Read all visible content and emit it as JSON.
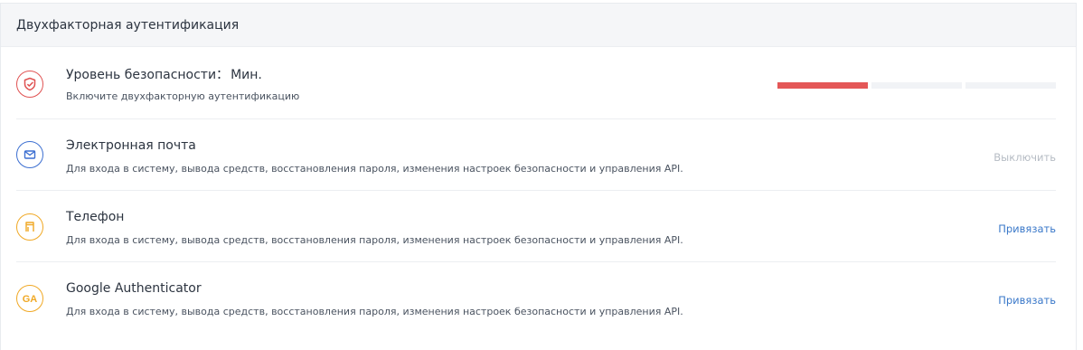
{
  "header": {
    "title": "Двухфакторная аутентификация"
  },
  "security": {
    "label": "Уровень безопасности：",
    "value": "Мин.",
    "description": "Включите двухфакторную аутентификацию",
    "icon": "shield-check-icon",
    "icon_color": "#e05252",
    "level_filled": 1,
    "level_total": 3,
    "filled_color": "#e45757",
    "empty_color": "#f1f3f6"
  },
  "methods": [
    {
      "title": "Электронная почта",
      "description": "Для входа в систему, вывода средств, восстановления пароля, изменения настроек безопасности и управления API.",
      "action": "Выключить",
      "action_color": "#b6bcc4",
      "icon": "envelope-icon",
      "icon_color": "#3c6fd1"
    },
    {
      "title": "Телефон",
      "description": "Для входа в систему, вывода средств, восстановления пароля, изменения настроек безопасности и управления API.",
      "action": "Привязать",
      "action_color": "#3a78c9",
      "icon": "phone-icon",
      "icon_color": "#f0a824"
    },
    {
      "title": "Google Authenticator",
      "description": "Для входа в систему, вывода средств, восстановления пароля, изменения настроек безопасности и управления API.",
      "action": "Привязать",
      "action_color": "#3a78c9",
      "icon": "google-authenticator-icon",
      "icon_color": "#f0a824"
    }
  ]
}
